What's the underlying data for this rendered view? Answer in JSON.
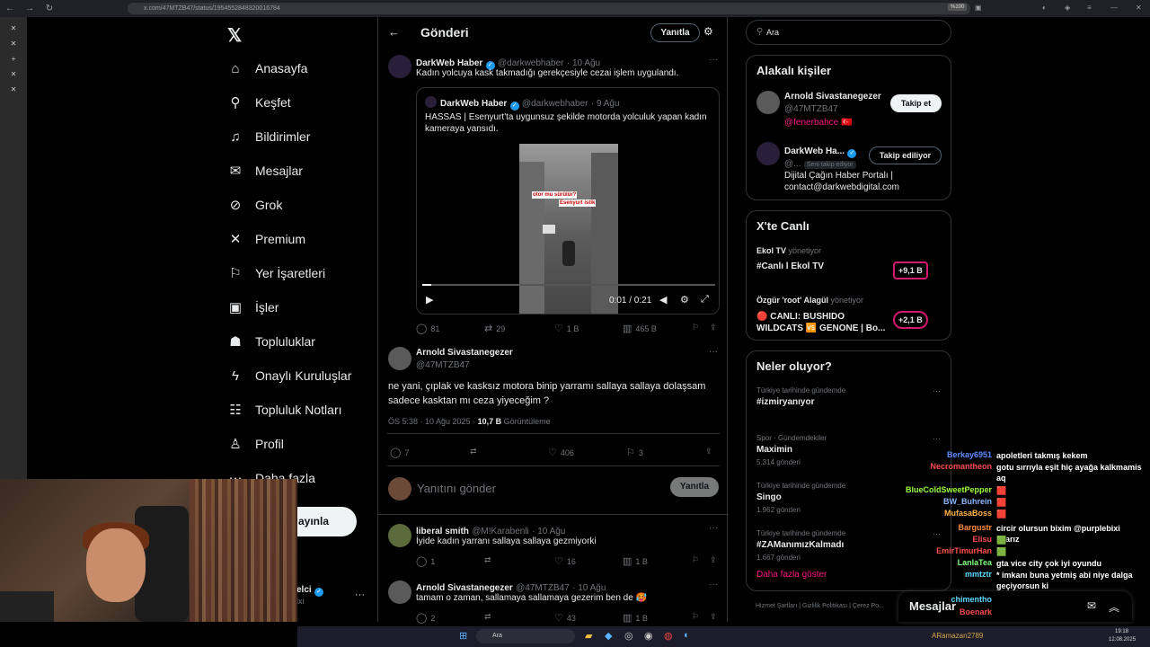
{
  "browser": {
    "url": "x.com/47MTZB47/status/1954552848320016784",
    "zoom": "%100"
  },
  "sidebar": {
    "items": [
      {
        "label": "Anasayfa",
        "icon": "home-icon"
      },
      {
        "label": "Keşfet",
        "icon": "search-icon"
      },
      {
        "label": "Bildirimler",
        "icon": "bell-icon"
      },
      {
        "label": "Mesajlar",
        "icon": "mail-icon"
      },
      {
        "label": "Grok",
        "icon": "grok-icon"
      },
      {
        "label": "Premium",
        "icon": "x-icon"
      },
      {
        "label": "Yer İşaretleri",
        "icon": "bookmark-icon"
      },
      {
        "label": "İşler",
        "icon": "briefcase-icon"
      },
      {
        "label": "Topluluklar",
        "icon": "people-icon"
      },
      {
        "label": "Onaylı Kuruluşlar",
        "icon": "lightning-icon"
      },
      {
        "label": "Topluluk Notları",
        "icon": "notes-icon"
      },
      {
        "label": "Profil",
        "icon": "person-icon"
      },
      {
        "label": "Daha fazla",
        "icon": "more-icon"
      }
    ],
    "post_button": "ayınla",
    "user_name": "elci",
    "user_handle": "ixi"
  },
  "header": {
    "title": "Gönderi",
    "reply_button": "Yanıtla"
  },
  "quoted_post": {
    "name": "DarkWeb Haber",
    "handle": "@darkwebhaber",
    "time": "· 10 Ağu",
    "text": "Kadın yolcuya kask takmadığı gerekçesiyle cezai işlem uygulandı.",
    "inner": {
      "name": "DarkWeb Haber",
      "handle": "@darkwebhaber",
      "time": "· 9 Ağu",
      "text": "HASSAS | Esenyurt'ta uygunsuz şekilde motorda yolculuk yapan kadın kameraya yansıdı.",
      "video_time": "0:01 / 0:21",
      "video_overlay_1": "otor mu sürülür?",
      "video_overlay_2": "Esenyurt istik"
    },
    "replies": "81",
    "reposts": "29",
    "likes": "1 B",
    "views": "465 B"
  },
  "main_post": {
    "name": "Arnold Sivastanegezer",
    "handle": "@47MTZB47",
    "text": "ne yani, çıplak ve kasksız motora binip yarramı sallaya sallaya dolaşsam sadece kasktan mı ceza yiyeceğim ?",
    "timestamp": "ÖS 5:38 · 10 Ağu 2025 · ",
    "views_count": "10,7 B",
    "views_label": "Görüntüleme",
    "replies": "7",
    "likes": "406",
    "bookmarks": "3"
  },
  "composer": {
    "placeholder": "Yanıtını gönder",
    "button": "Yanıtla"
  },
  "replies": [
    {
      "name": "liberal smith",
      "handle": "@M!Karabenli",
      "time": "· 10 Ağu",
      "text": "İyide kadın yarranı sallaya sallaya gezmiyorki",
      "replies": "1",
      "likes": "16",
      "views": "1 B"
    },
    {
      "name": "Arnold Sivastanegezer",
      "handle": "@47MTZB47",
      "time": "· 10 Ağu",
      "text": "tamam o zaman, sallamaya sallamaya gezerim ben de 🥵",
      "replies": "2",
      "likes": "43",
      "views": "1 B"
    }
  ],
  "search": {
    "value": "Ara"
  },
  "related": {
    "title": "Alakalı kişiler",
    "people": [
      {
        "name": "Arnold Sivastanegezer",
        "handle": "@47MTZB47",
        "bio": "@fenerbahce 🇹🇷",
        "button": "Takip et"
      },
      {
        "name": "DarkWeb Ha...",
        "handle": "@...",
        "follows_you": "Seni takip ediyor",
        "bio": "Dijital Çağın Haber Portalı | contact@darkwebdigital.com",
        "button": "Takip ediliyor"
      }
    ]
  },
  "live": {
    "title": "X'te Canlı",
    "items": [
      {
        "host": "Ekol TV",
        "role": "yönetiyor",
        "title": "#Canlı l Ekol TV",
        "count": "+9,1 B"
      },
      {
        "host": "Özgür 'root' Alagül",
        "role": "yönetiyor",
        "title": "🔴 CANLI: BUSHIDO WILDCATS 🆚 GENONE | Bo...",
        "count": "+2,1 B"
      }
    ]
  },
  "trends": {
    "title": "Neler oluyor?",
    "items": [
      {
        "category": "Türkiye tarihinde gündemde",
        "topic": "#izmiryanıyor",
        "count": ""
      },
      {
        "category": "Spor · Gündemdekiler",
        "topic": "Maximin",
        "count": "5.314 gönderi"
      },
      {
        "category": "Türkiye tarihinde gündemde",
        "topic": "Singo",
        "count": "1.962 gönderi"
      },
      {
        "category": "Türkiye tarihinde gündemde",
        "topic": "#ZAManımızKalmadı",
        "count": "1.667 gönderi"
      }
    ],
    "show_more": "Daha fazla göster"
  },
  "footer": {
    "links": "Hizmet Şartları | Gizlilik Politikası | Çerez Po..."
  },
  "messages_bar": {
    "label": "Mesajlar"
  },
  "chat": [
    {
      "user": "Berkay6951",
      "msg": "apoletleri takmış kekem",
      "color": "#5b8cff"
    },
    {
      "user": "Necromantheon",
      "msg": "gotu sırrıyla eşit hiç ayağa kalkmamis aq",
      "color": "#ff4d4d"
    },
    {
      "user": "BlueColdSweetPepper",
      "msg": "🟥",
      "color": "#9aff3c"
    },
    {
      "user": "BW_Buhrein",
      "msg": "🟥",
      "color": "#8ab4ff"
    },
    {
      "user": "MufasaBoss",
      "msg": "🟥",
      "color": "#ffb347"
    },
    {
      "user": "Bargustr",
      "msg": "circir olursun bixim @purplebixi akarız",
      "color": "#ff8a3c"
    },
    {
      "user": "Elisu",
      "msg": "🟩",
      "color": "#ff4d4d"
    },
    {
      "user": "EmirTimurHan",
      "msg": "🟩",
      "color": "#ff4d4d"
    },
    {
      "user": "LanlaTea",
      "msg": "gta vice city çok iyi oyundu",
      "color": "#7fff7f"
    },
    {
      "user": "mmtztr",
      "msg": "* imkanı buna yetmiş abi niye dalga geçiyorsun ki",
      "color": "#5bd9ff"
    },
    {
      "user": "chimentho",
      "msg": "",
      "color": "#5bd9ff"
    },
    {
      "user": "Boenark",
      "msg": "",
      "color": "#ff4d4d"
    }
  ],
  "taskbar": {
    "search": "Ara",
    "user": "ARamazan2789",
    "time": "19:18",
    "date": "12.08.2025"
  }
}
